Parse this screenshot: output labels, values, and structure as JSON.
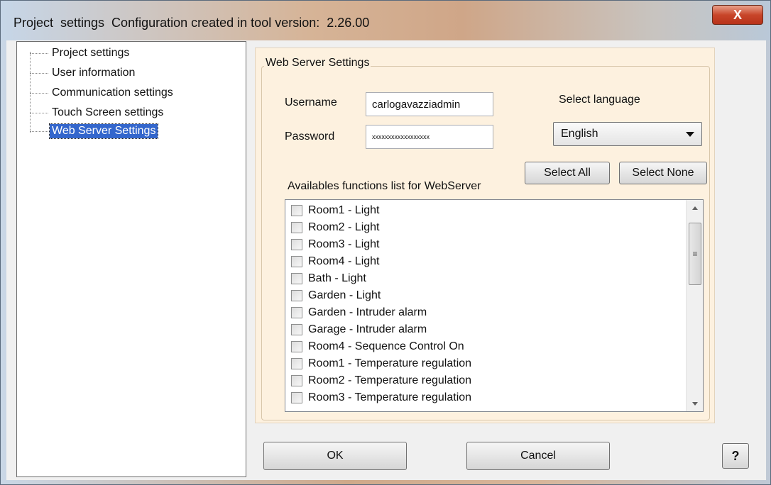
{
  "window": {
    "title": "Project  settings  Configuration created in tool version:  2.26.00",
    "close_glyph": "X"
  },
  "tree": {
    "items": [
      {
        "label": "Project  settings"
      },
      {
        "label": "User information"
      },
      {
        "label": "Communication settings"
      },
      {
        "label": "Touch Screen settings"
      },
      {
        "label": "Web Server Settings",
        "selected": true
      }
    ]
  },
  "webserver": {
    "group_title": "Web Server Settings",
    "username_label": "Username",
    "username_value": "carlogavazziadmin",
    "password_label": "Password",
    "password_value": "xxxxxxxxxxxxxxxxxx",
    "language_label": "Select language",
    "language_value": "English",
    "functions_label": "Availables functions list for WebServer",
    "select_all_label": "Select All",
    "select_none_label": "Select None",
    "functions": [
      {
        "label": "Room1 - Light",
        "checked": false
      },
      {
        "label": "Room2 - Light",
        "checked": false
      },
      {
        "label": "Room3 - Light",
        "checked": false
      },
      {
        "label": "Room4 - Light",
        "checked": false
      },
      {
        "label": "Bath - Light",
        "checked": false
      },
      {
        "label": "Garden - Light",
        "checked": false
      },
      {
        "label": "Garden - Intruder alarm",
        "checked": false
      },
      {
        "label": "Garage - Intruder alarm",
        "checked": false
      },
      {
        "label": "Room4 - Sequence Control On",
        "checked": false
      },
      {
        "label": "Room1 - Temperature regulation",
        "checked": false
      },
      {
        "label": "Room2 - Temperature regulation",
        "checked": false
      },
      {
        "label": "Room3 - Temperature regulation",
        "checked": false
      }
    ]
  },
  "footer": {
    "ok_label": "OK",
    "cancel_label": "Cancel",
    "help_label": "?"
  }
}
